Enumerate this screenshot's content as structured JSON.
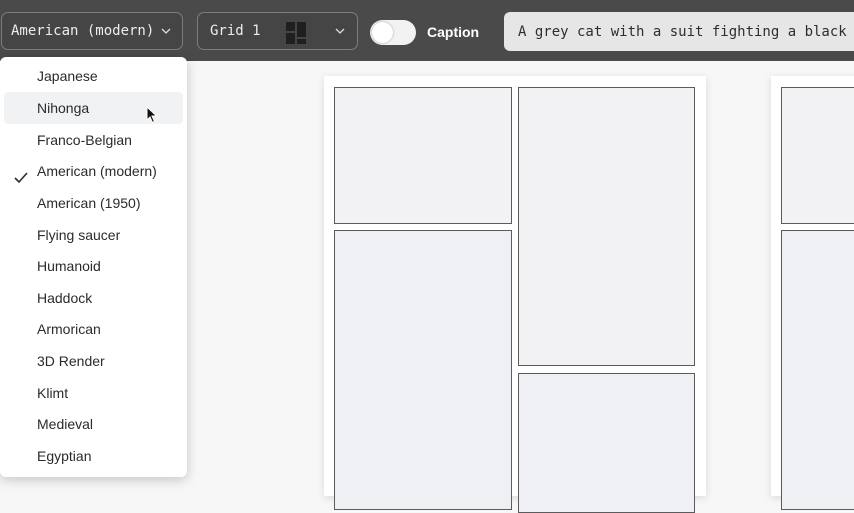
{
  "toolbar": {
    "style_value": "American (modern)",
    "grid_value": "Grid 1",
    "caption_label": "Caption",
    "caption_enabled": false,
    "prompt_value": "A grey cat with a suit fighting a black"
  },
  "style_menu": {
    "items": [
      {
        "label": "Japanese"
      },
      {
        "label": "Nihonga"
      },
      {
        "label": "Franco-Belgian"
      },
      {
        "label": "American (modern)"
      },
      {
        "label": "American (1950)"
      },
      {
        "label": "Flying saucer"
      },
      {
        "label": "Humanoid"
      },
      {
        "label": "Haddock"
      },
      {
        "label": "Armorican"
      },
      {
        "label": "3D Render"
      },
      {
        "label": "Klimt"
      },
      {
        "label": "Medieval"
      },
      {
        "label": "Egyptian"
      }
    ],
    "selected": "American (modern)",
    "hovered": "Nihonga"
  },
  "icons": {
    "dropdown": "chevron-down-icon",
    "grid_layout": "grid-layout-icon",
    "selected": "checkmark-icon",
    "pointer": "mouse-cursor-icon"
  }
}
